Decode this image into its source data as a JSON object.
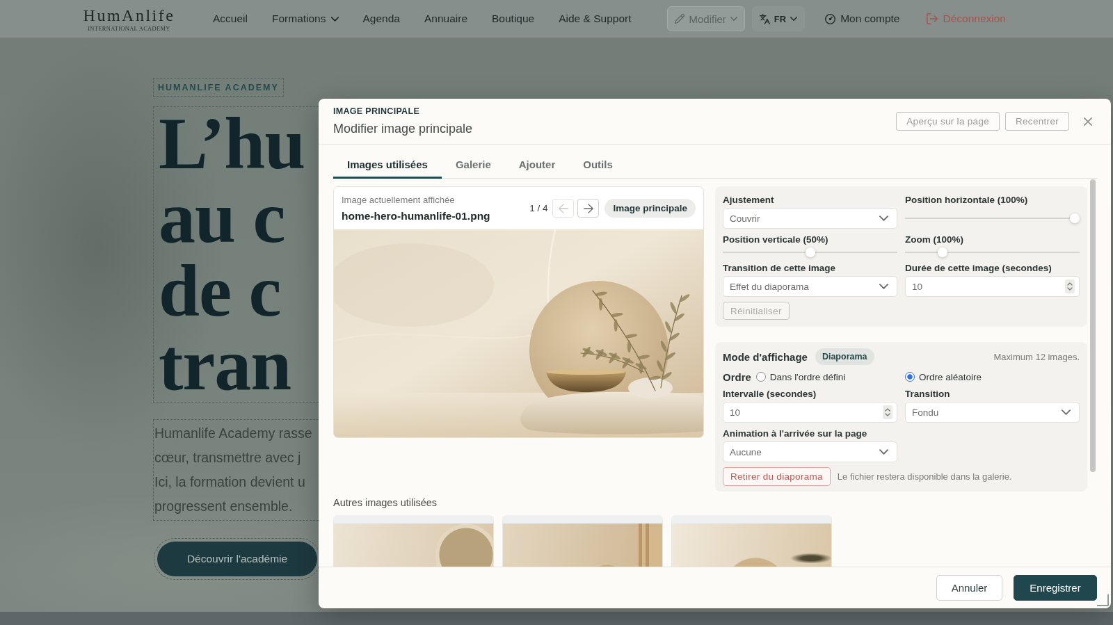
{
  "nav": {
    "logo": "HumAnlife",
    "logo_subtitle": "INTERNATIONAL ACADEMY",
    "links": [
      {
        "label": "Accueil",
        "dropdown": false
      },
      {
        "label": "Formations",
        "dropdown": true
      },
      {
        "label": "Agenda",
        "dropdown": false
      },
      {
        "label": "Annuaire",
        "dropdown": false
      },
      {
        "label": "Boutique",
        "dropdown": false
      },
      {
        "label": "Aide & Support",
        "dropdown": false
      }
    ],
    "edit_button": "Modifier",
    "language_button": "FR",
    "account_link": "Mon compte",
    "logout_link": "Déconnexion"
  },
  "hero": {
    "eyebrow": "HUMANLIFE ACADEMY",
    "heading_lines": [
      "L’hu",
      "au c",
      "de c",
      "tran"
    ],
    "paragraph_lines": [
      "Humanlife Academy rasse",
      "cœur, transmettre avec j",
      "Ici, la formation devient u",
      "progressent ensemble."
    ],
    "button": "Découvrir l'académie"
  },
  "modal": {
    "eyebrow": "IMAGE PRINCIPALE",
    "title": "Modifier image principale",
    "header_buttons": [
      "Aperçu sur la page",
      "Recentrer"
    ],
    "tabs": [
      {
        "label": "Images utilisées",
        "selected": true
      },
      {
        "label": "Galerie",
        "selected": false
      },
      {
        "label": "Ajouter",
        "selected": false
      },
      {
        "label": "Outils",
        "selected": false
      }
    ],
    "current_image": {
      "caption": "Image actuellement affichée",
      "filename": "home-hero-humanlife-01.png",
      "counter": "1 / 4",
      "previous_disabled": true,
      "next_disabled": false,
      "badge": "Image principale"
    },
    "image_settings": {
      "fields": [
        {
          "kind": "select",
          "label": "Ajustement",
          "value": "Couvrir"
        },
        {
          "kind": "slider",
          "label": "Position horizontale (100%)",
          "level": 1
        },
        {
          "kind": "slider",
          "label": "Position verticale (50%)",
          "level": 0.5
        },
        {
          "kind": "slider",
          "label": "Zoom (100%)",
          "level": 0.2
        },
        {
          "kind": "select",
          "label": "Transition de cette image",
          "value": "Effet du diaporama"
        },
        {
          "kind": "number",
          "label": "Durée de cette image (secondes)",
          "value": "10"
        }
      ],
      "reset_button": {
        "label": "Réinitialiser",
        "disabled": true
      }
    },
    "display_mode": {
      "title": "Mode d'affichage",
      "badge": "Diaporama",
      "note": "Maximum 12 images.",
      "order_label": "Ordre",
      "order_options": [
        {
          "label": "Dans l'ordre défini",
          "selected": false
        },
        {
          "label": "Ordre aléatoire",
          "selected": true
        }
      ],
      "fields": [
        {
          "kind": "number",
          "label": "Intervalle (secondes)",
          "value": "10"
        },
        {
          "kind": "select",
          "label": "Transition",
          "value": "Fondu"
        },
        {
          "kind": "select",
          "label": "Animation à l'arrivée sur la page",
          "value": "Aucune"
        }
      ],
      "remove_button": "Retirer du diaporama",
      "remove_note": "Le fichier restera disponible dans la galerie."
    },
    "other_images": {
      "title": "Autres images utilisées",
      "thumbnails": [
        {
          "kind": "photo"
        },
        {
          "kind": "photo"
        },
        {
          "kind": "photo"
        }
      ]
    },
    "footer_buttons": [
      {
        "label": "Annuler",
        "kind": "secondary"
      },
      {
        "label": "Enregistrer",
        "kind": "primary"
      }
    ]
  }
}
